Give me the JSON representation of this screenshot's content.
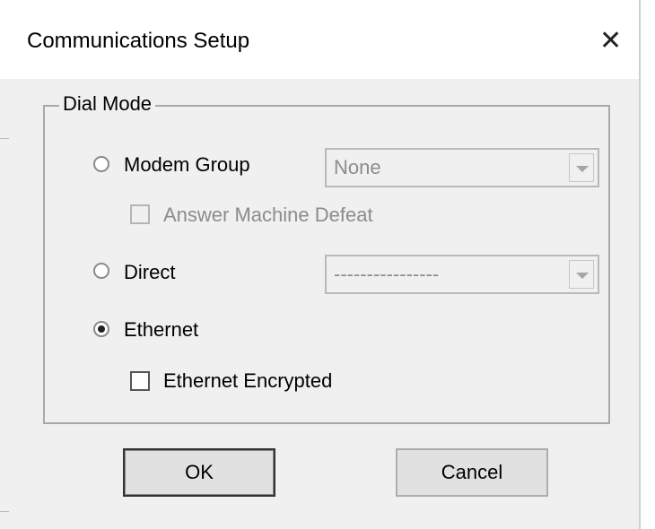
{
  "dialog": {
    "title": "Communications Setup",
    "close_glyph": "✕"
  },
  "dial_mode": {
    "group_label": "Dial Mode",
    "modem_group": {
      "label": "Modem Group",
      "selected": false,
      "select_value": "None",
      "select_enabled": false
    },
    "answer_machine_defeat": {
      "label": "Answer Machine Defeat",
      "checked": false,
      "enabled": false
    },
    "direct": {
      "label": "Direct",
      "selected": false,
      "select_value": "----------------",
      "select_enabled": false
    },
    "ethernet": {
      "label": "Ethernet",
      "selected": true
    },
    "ethernet_encrypted": {
      "label": "Ethernet Encrypted",
      "checked": false,
      "enabled": true
    }
  },
  "buttons": {
    "ok_label": "OK",
    "cancel_label": "Cancel"
  }
}
